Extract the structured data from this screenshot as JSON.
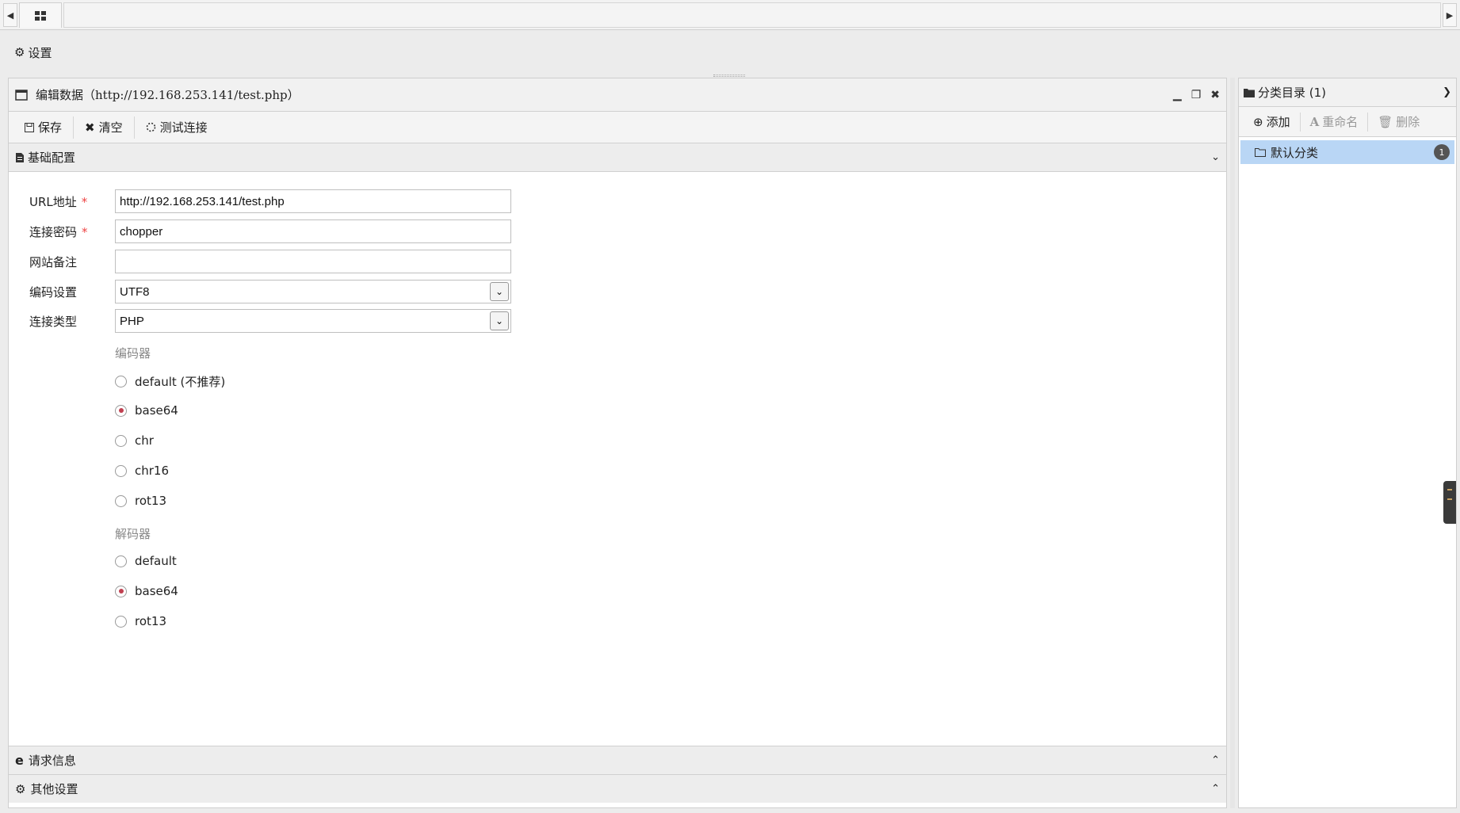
{
  "menubar": {
    "settings_label": "设置"
  },
  "editor": {
    "title": "编辑数据（http://192.168.253.141/test.php）",
    "toolbar": {
      "save": "保存",
      "clear": "清空",
      "test": "测试连接"
    },
    "basic_section": "基础配置",
    "fields": {
      "url": {
        "label": "URL地址",
        "required": "*",
        "value": "http://192.168.253.141/test.php"
      },
      "password": {
        "label": "连接密码",
        "required": "*",
        "value": "chopper"
      },
      "note": {
        "label": "网站备注",
        "value": ""
      },
      "encoding": {
        "label": "编码设置",
        "value": "UTF8"
      },
      "type": {
        "label": "连接类型",
        "value": "PHP"
      }
    },
    "encoder": {
      "label": "编码器",
      "options": [
        "default (不推荐)",
        "base64",
        "chr",
        "chr16",
        "rot13"
      ],
      "selected": "base64"
    },
    "decoder": {
      "label": "解码器",
      "options": [
        "default",
        "base64",
        "rot13"
      ],
      "selected": "base64"
    },
    "request_section": "请求信息",
    "other_section": "其他设置"
  },
  "sidebar": {
    "title": "分类目录 (1)",
    "toolbar": {
      "add": "添加",
      "rename": "重命名",
      "delete": "删除"
    },
    "categories": [
      {
        "label": "默认分类",
        "count": "1"
      }
    ]
  }
}
